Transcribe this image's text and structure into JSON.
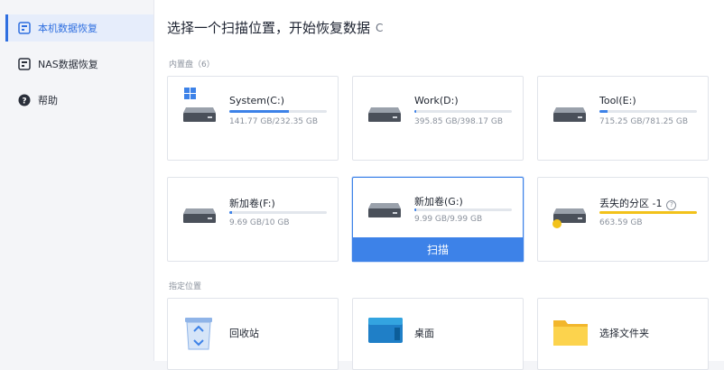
{
  "sidebar": {
    "items": [
      {
        "label": "本机数据恢复",
        "icon": "local-recovery-icon",
        "active": true
      },
      {
        "label": "NAS数据恢复",
        "icon": "nas-recovery-icon",
        "active": false
      },
      {
        "label": "帮助",
        "icon": "help-icon",
        "active": false
      }
    ]
  },
  "main": {
    "title": "选择一个扫描位置，开始恢复数据",
    "refresh_icon": "C",
    "internal_section": "内置盘（6）",
    "drives": [
      {
        "name": "System(C:)",
        "size": "141.77 GB/232.35 GB",
        "used_fraction": 0.61,
        "icon": "windows-drive-icon"
      },
      {
        "name": "Work(D:)",
        "size": "395.85 GB/398.17 GB",
        "used_fraction": 0.02,
        "icon": "hard-drive-icon"
      },
      {
        "name": "Tool(E:)",
        "size": "715.25 GB/781.25 GB",
        "used_fraction": 0.08,
        "icon": "hard-drive-icon"
      },
      {
        "name": "新加卷(F:)",
        "size": "9.69 GB/10 GB",
        "used_fraction": 0.03,
        "icon": "hard-drive-icon"
      },
      {
        "name": "新加卷(G:)",
        "size": "9.99 GB/9.99 GB",
        "used_fraction": 0.01,
        "icon": "hard-drive-icon",
        "selected": true
      },
      {
        "name": "丢失的分区 -1",
        "size": "663.59 GB",
        "used_fraction": 1.0,
        "icon": "lost-partition-icon",
        "bar_color": "#f2c21a"
      }
    ],
    "scan_label": "扫描",
    "location_section": "指定位置",
    "locations": [
      {
        "name": "回收站",
        "icon": "recycle-bin-icon"
      },
      {
        "name": "桌面",
        "icon": "desktop-icon"
      },
      {
        "name": "选择文件夹",
        "icon": "folder-icon"
      }
    ]
  },
  "colors": {
    "accent": "#3d82e8",
    "warning": "#f2c21a",
    "sidebar_bg": "#f4f5f8"
  }
}
